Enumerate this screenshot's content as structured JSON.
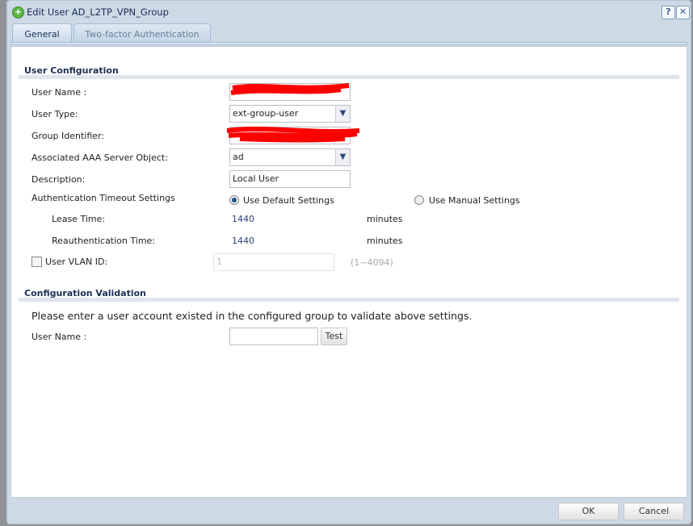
{
  "dialog": {
    "title": "Edit User AD_L2TP_VPN_Group",
    "help_label": "?",
    "close_label": "✕"
  },
  "tabs": [
    {
      "label": "General",
      "active": true
    },
    {
      "label": "Two-factor Authentication",
      "active": false
    }
  ],
  "user_config": {
    "heading": "User Configuration",
    "user_name_label": "User Name :",
    "user_type_label": "User Type:",
    "user_type_value": "ext-group-user",
    "group_identifier_label": "Group Identifier:",
    "aaa_label": "Associated AAA Server Object:",
    "aaa_value": "ad",
    "description_label": "Description:",
    "description_value": "Local User",
    "auth_timeout_label": "Authentication Timeout Settings",
    "use_default_label": "Use Default Settings",
    "use_manual_label": "Use Manual Settings",
    "lease_label": "Lease Time:",
    "lease_value": "1440",
    "lease_unit": "minutes",
    "reauth_label": "Reauthentication Time:",
    "reauth_value": "1440",
    "reauth_unit": "minutes",
    "vlan_label": "User VLAN ID:",
    "vlan_value": "1",
    "vlan_range": "(1~4094)"
  },
  "validation": {
    "heading": "Configuration Validation",
    "instruction": "Please enter a user account existed in the configured group to validate above settings.",
    "user_name_label": "User Name :",
    "test_label": "Test"
  },
  "footer": {
    "ok_label": "OK",
    "cancel_label": "Cancel"
  },
  "colors": {
    "redaction": "#ff0000",
    "accent": "#1c2f55"
  }
}
